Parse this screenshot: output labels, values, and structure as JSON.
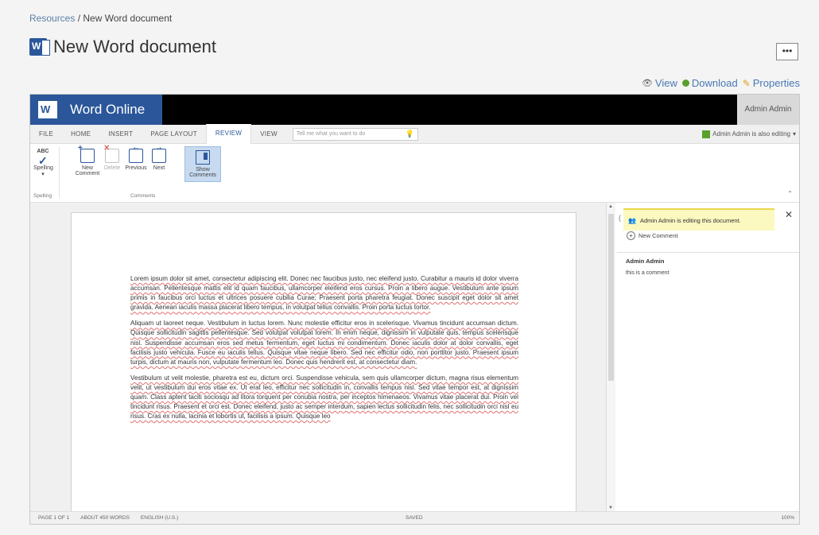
{
  "breadcrumb": {
    "root": "Resources",
    "separator": "/",
    "current": "New Word document"
  },
  "page": {
    "title": "New Word document",
    "more_label": "•••"
  },
  "actions": {
    "view": "View",
    "download": "Download",
    "properties": "Properties"
  },
  "app": {
    "name": "Word Online",
    "user": "Admin Admin"
  },
  "tabs": [
    {
      "label": "FILE"
    },
    {
      "label": "HOME"
    },
    {
      "label": "INSERT"
    },
    {
      "label": "PAGE LAYOUT"
    },
    {
      "label": "REVIEW"
    },
    {
      "label": "VIEW"
    }
  ],
  "tell_me": {
    "placeholder": "Tell me what you want to do"
  },
  "editing_note": "Admin Admin is also editing",
  "ribbon": {
    "spelling": {
      "label": "Spelling",
      "icon_text": "ABC"
    },
    "new_comment": {
      "label_line1": "New",
      "label_line2": "Comment"
    },
    "delete": {
      "label": "Delete"
    },
    "previous": {
      "label": "Previous"
    },
    "next": {
      "label": "Next"
    },
    "show_comments": {
      "label_line1": "Show",
      "label_line2": "Comments"
    },
    "groups": {
      "spelling": "Spelling",
      "comments": "Comments"
    }
  },
  "document": {
    "paragraphs": [
      "Lorem ipsum dolor sit amet, consectetur adipiscing elit. Donec nec faucibus justo, nec eleifend justo. Curabitur a mauris id dolor viverra accumsan. Pellentesque mattis elit id quam faucibus, ullamcorper eleifend eros cursus. Proin a libero augue. Vestibulum ante ipsum primis in faucibus orci luctus et ultrices posuere cubilia Curae; Praesent porta pharetra feugiat. Donec suscipit eget dolor sit amet gravida. Aenean iaculis massa placerat libero tempus, in volutpat tellus convallis. Proin porta luctus tortor.",
      "Aliquam ut laoreet neque. Vestibulum in luctus lorem. Nunc molestie efficitur eros in scelerisque. Vivamus tincidunt accumsan dictum. Quisque sollicitudin sagittis pellentesque. Sed volutpat volutpat lorem. In enim neque, dignissim in vulputate quis, tempus scelerisque nisl. Suspendisse accumsan eros sed metus fermentum, eget luctus mi condimentum. Donec iaculis dolor at dolor convallis, eget facilisis justo vehicula. Fusce eu iaculis tellus. Quisque vitae neque libero. Sed nec efficitur odio, non porttitor justo. Praesent ipsum turpis, dictum at mauris non, vulputate fermentum leo. Donec quis hendrerit est, at consectetur diam.",
      "Vestibulum ut velit molestie, pharetra est eu, dictum orci. Suspendisse vehicula, sem quis ullamcorper dictum, magna risus elementum velit, ut vestibulum dui eros vitae ex. Ut erat leo, efficitur nec sollicitudin in, convallis tempus nisl. Sed vitae tempor est, at dignissim quam. Class aptent taciti sociosqu ad litora torquent per conubia nostra, per inceptos himenaeos. Vivamus vitae placerat dui. Proin vel tincidunt risus. Praesent et orci est. Donec eleifend, justo ac semper interdum, sapien lectus sollicitudin felis, nec sollicitudin orci nisl eu risus. Cras ex nulla, lacinia et lobortis ut, facilisis a ipsum. Quisque leo"
    ]
  },
  "comments_pane": {
    "banner": "Admin Admin is editing this document.",
    "new_comment": "New Comment",
    "comments": [
      {
        "author": "Admin Admin",
        "text": "this is a comment"
      }
    ]
  },
  "status": {
    "page": "PAGE 1 OF 1",
    "words": "ABOUT 450 WORDS",
    "language": "ENGLISH (U.S.)",
    "saved": "SAVED",
    "zoom": "100%"
  },
  "colors": {
    "brand": "#2b579a",
    "banner": "#fbf8c0",
    "spell_error": "#e07070"
  }
}
